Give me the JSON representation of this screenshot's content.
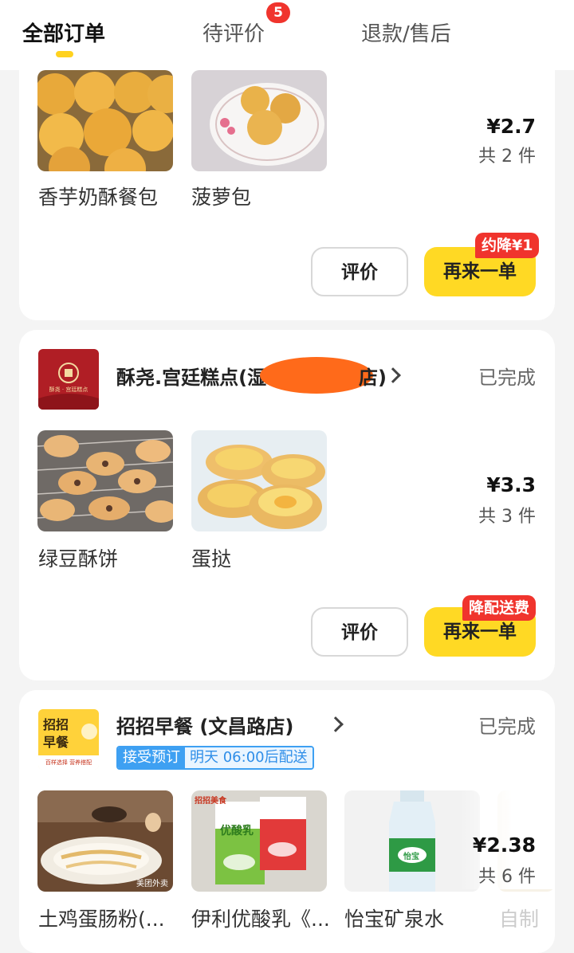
{
  "tabs": {
    "all": "全部订单",
    "pending_review": "待评价",
    "pending_badge": "5",
    "refund": "退款/售后"
  },
  "orders": [
    {
      "items": [
        "香芋奶酥餐包",
        "菠萝包"
      ],
      "price": "¥2.7",
      "count": "共 2 件",
      "review_label": "评价",
      "reorder_label": "再来一单",
      "promo": "约降¥1"
    },
    {
      "shop_name": "酥尧.宫廷糕点(湿",
      "shop_name_tail": "店)",
      "logo_text": "酥尧 · 宫廷糕点",
      "status": "已完成",
      "items": [
        "绿豆酥饼",
        "蛋挞"
      ],
      "price": "¥3.3",
      "count": "共 3 件",
      "review_label": "评价",
      "reorder_label": "再来一单",
      "promo": "降配送费"
    },
    {
      "shop_name": "招招早餐 (文昌路店)",
      "logo_text_top": "招招",
      "logo_text_mid": "早餐",
      "logo_text_bottom": "百样选择 营养搭配",
      "status": "已完成",
      "preorder_label": "接受预订",
      "preorder_time": "明天 06:00后配送",
      "items": [
        "土鸡蛋肠粉(...",
        "伊利优酸乳《...",
        "怡宝矿泉水",
        "自制"
      ],
      "price": "¥2.38",
      "count": "共 6 件",
      "thumb_labels": [
        "美团外卖",
        "招招美食",
        "优酸乳",
        "怡宝"
      ]
    }
  ],
  "colors": {
    "accent_yellow": "#ffd924",
    "badge_red": "#f0342d",
    "preorder_blue": "#3ea0f2"
  }
}
